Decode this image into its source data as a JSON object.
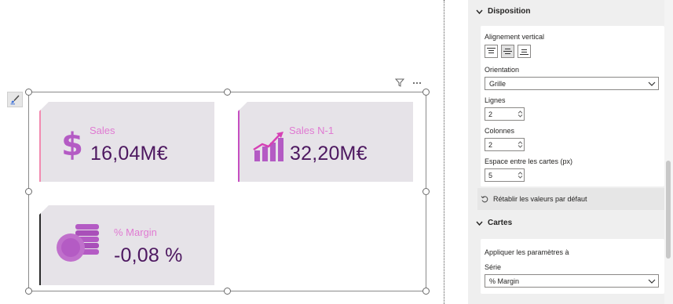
{
  "canvas": {
    "cards": [
      {
        "label": "Sales",
        "value": "16,04M€",
        "icon": "dollar-icon",
        "accent": "#f28ab0"
      },
      {
        "label": "Sales N-1",
        "value": "32,20M€",
        "icon": "growth-chart-icon",
        "accent": "#c64fc1"
      },
      {
        "label": "% Margin",
        "value": "-0,08 %",
        "icon": "coins-icon",
        "accent": "#2a2a2a"
      }
    ],
    "icons": {
      "edit": "paint-brush-icon",
      "filter": "filter-icon",
      "more": "more-options-icon"
    }
  },
  "pane": {
    "disposition": {
      "title": "Disposition",
      "vertical_alignment_label": "Alignement vertical",
      "orientation_label": "Orientation",
      "orientation_value": "Grille",
      "rows_label": "Lignes",
      "rows_value": "2",
      "columns_label": "Colonnes",
      "columns_value": "2",
      "spacing_label": "Espace entre les cartes (px)",
      "spacing_value": "5",
      "reset_label": "Rétablir les valeurs par défaut"
    },
    "cards_section": {
      "title": "Cartes",
      "apply_label": "Appliquer les paramètres à",
      "series_label": "Série",
      "series_value": "% Margin"
    }
  },
  "colors": {
    "label_pink": "#e07ad2",
    "value_purple": "#4d1860",
    "icon_purple": "#b45bc4",
    "card_bg": "#e6e3e8"
  }
}
